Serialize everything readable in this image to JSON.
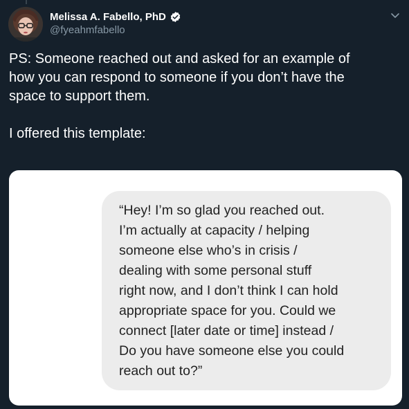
{
  "author": {
    "display_name": "Melissa A. Fabello, PhD",
    "handle": "@fyeahmfabello",
    "verified_icon": "verified-badge-icon",
    "avatar_icon": "profile-photo"
  },
  "tweet": {
    "paragraph_1": [
      "PS: Someone reached out and asked for an example of",
      "how you can respond to someone if you don’t have the",
      "space to support them."
    ],
    "paragraph_2": "I offered this template:"
  },
  "media": {
    "message_lines": [
      "“Hey! I’m so glad you reached out.",
      "I’m actually at capacity / helping",
      "someone else who’s in crisis /",
      "dealing with some personal stuff",
      "right now, and I don’t think I can hold",
      "appropriate space for you. Could we",
      "connect [later date or time] instead /",
      "Do you have someone else you could",
      "reach out to?”"
    ]
  },
  "colors": {
    "background": "#15202b",
    "secondary_text": "#8899a6",
    "bubble": "#ececec",
    "verified": "#ffffff"
  }
}
